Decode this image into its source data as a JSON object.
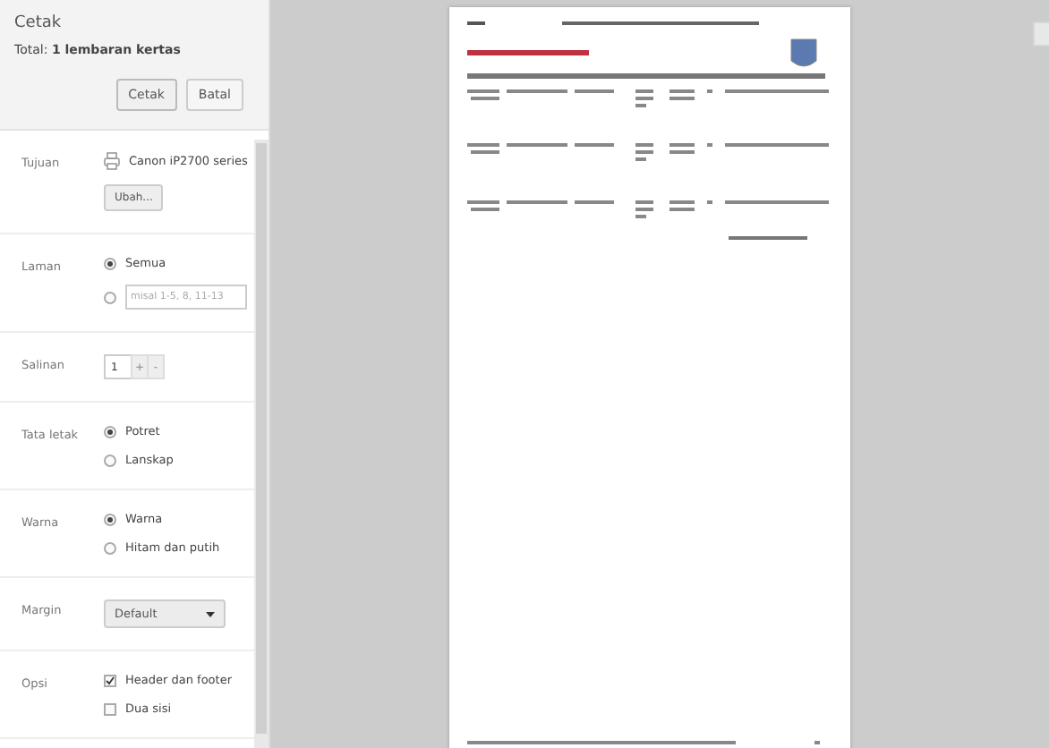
{
  "header": {
    "title": "Cetak",
    "total": "Total: **1 lembaran kertas**",
    "buttons": [
      {
        "label": "Cetak",
        "kind": "primary"
      },
      {
        "label": "Batal",
        "kind": "secondary"
      }
    ]
  },
  "settings": [
    {
      "label": "Tujuan",
      "kind": "destination",
      "printer": "Canon iP2700 series",
      "button": "Ubah..."
    },
    {
      "label": "Laman",
      "kind": "radios",
      "options": [
        {
          "label": "Semua",
          "selected": true,
          "kind": "plain"
        },
        {
          "placeholder": "misal 1-5, 8, 11-13",
          "selected": false,
          "kind": "field"
        }
      ]
    },
    {
      "label": "Salinan",
      "kind": "copies",
      "value": "1",
      "plus": "+",
      "minus": "-"
    },
    {
      "label": "Tata letak",
      "kind": "radios",
      "options": [
        {
          "label": "Potret",
          "selected": true,
          "kind": "plain"
        },
        {
          "label": "Lanskap",
          "selected": false,
          "kind": "plain"
        }
      ]
    },
    {
      "label": "Warna",
      "kind": "radios",
      "options": [
        {
          "label": "Warna",
          "selected": true,
          "kind": "plain"
        },
        {
          "label": "Hitam dan putih",
          "selected": false,
          "kind": "plain"
        }
      ]
    },
    {
      "label": "Margin",
      "kind": "select",
      "value": "Default"
    },
    {
      "label": "Opsi",
      "kind": "checks",
      "options": [
        {
          "label": "Header dan footer",
          "checked": true
        },
        {
          "label": "Dua sisi",
          "checked": false
        }
      ]
    }
  ]
}
